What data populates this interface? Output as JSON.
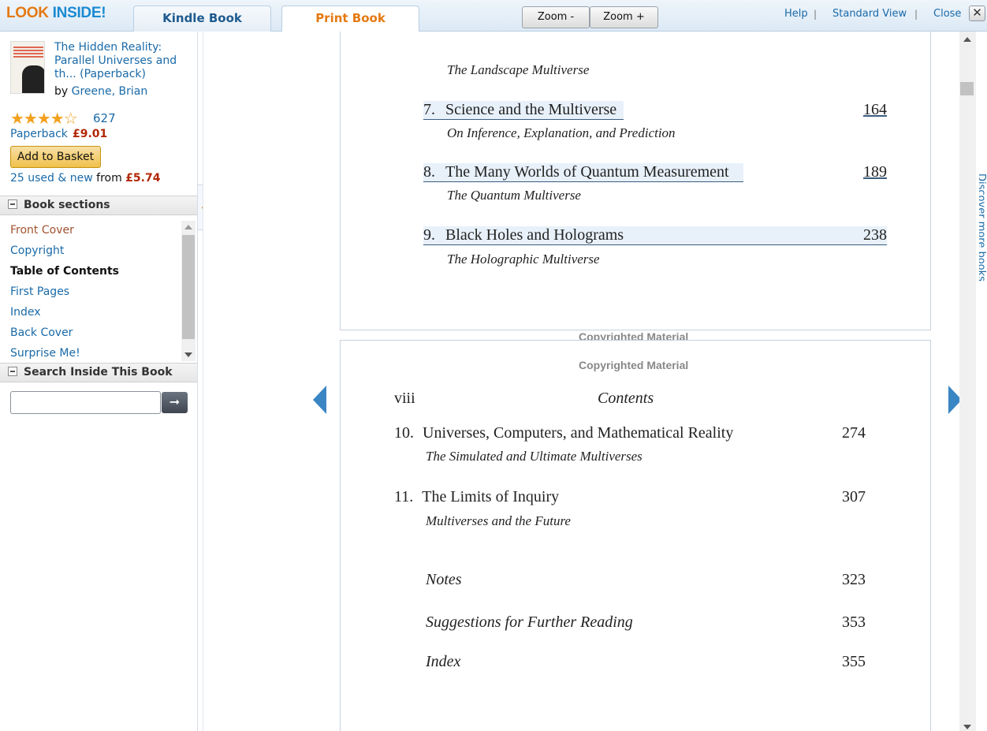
{
  "topbar": {
    "logo_part1": "LOOK",
    "logo_part2": "INSIDE!",
    "tabs": [
      {
        "label": "Kindle Book"
      },
      {
        "label": "Print Book"
      }
    ],
    "zoom_out_label": "Zoom -",
    "zoom_in_label": "Zoom +",
    "help_label": "Help",
    "standard_view_label": "Standard View",
    "close_label": "Close",
    "separator": "|",
    "close_icon": "close-icon"
  },
  "book": {
    "title": "The Hidden Reality: Parallel Universes and th... (Paperback)",
    "by": "by",
    "author": "Greene, Brian",
    "stars": "★★★★☆",
    "rating_count": "627",
    "format": "Paperback",
    "price": "£9.01",
    "add_to_basket": "Add to Basket",
    "used_new": "25 used & new",
    "from": "from",
    "used_price": "£5.74"
  },
  "sections": {
    "heading": "Book sections",
    "items": [
      {
        "label": "Front Cover"
      },
      {
        "label": "Copyright"
      },
      {
        "label": "Table of Contents"
      },
      {
        "label": "First Pages"
      },
      {
        "label": "Index"
      },
      {
        "label": "Back Cover"
      },
      {
        "label": "Surprise Me!"
      }
    ]
  },
  "search": {
    "heading": "Search Inside This Book",
    "value": "",
    "go_icon": "arrow-right-icon",
    "go_glyph": "➞"
  },
  "collapse_glyph": "«",
  "side_tab": "Discover more books",
  "page1": {
    "top_subtitle": "The Landscape Multiverse",
    "chapters": [
      {
        "num": "7.",
        "title": "Science and the Multiverse",
        "subtitle": "On Inference, Explanation, and Prediction",
        "page": "164"
      },
      {
        "num": "8.",
        "title": "The Many Worlds of Quantum Measurement",
        "subtitle": "The Quantum Multiverse",
        "page": "189"
      },
      {
        "num": "9.",
        "title": "Black Holes and Holograms",
        "subtitle": "The Holographic Multiverse",
        "page": "238"
      }
    ],
    "copyright_mark": "Copyrighted Material"
  },
  "page2": {
    "copyright_mark": "Copyrighted Material",
    "folio": "viii",
    "running_head": "Contents",
    "chapters": [
      {
        "num": "10.",
        "title": "Universes, Computers, and Mathematical Reality",
        "subtitle": "The Simulated and Ultimate Multiverses",
        "page": "274"
      },
      {
        "num": "11.",
        "title": "The Limits of Inquiry",
        "subtitle": "Multiverses and the Future",
        "page": "307"
      }
    ],
    "backmatter": [
      {
        "title": "Notes",
        "page": "323"
      },
      {
        "title": "Suggestions for Further Reading",
        "page": "353"
      },
      {
        "title": "Index",
        "page": "355"
      }
    ]
  }
}
